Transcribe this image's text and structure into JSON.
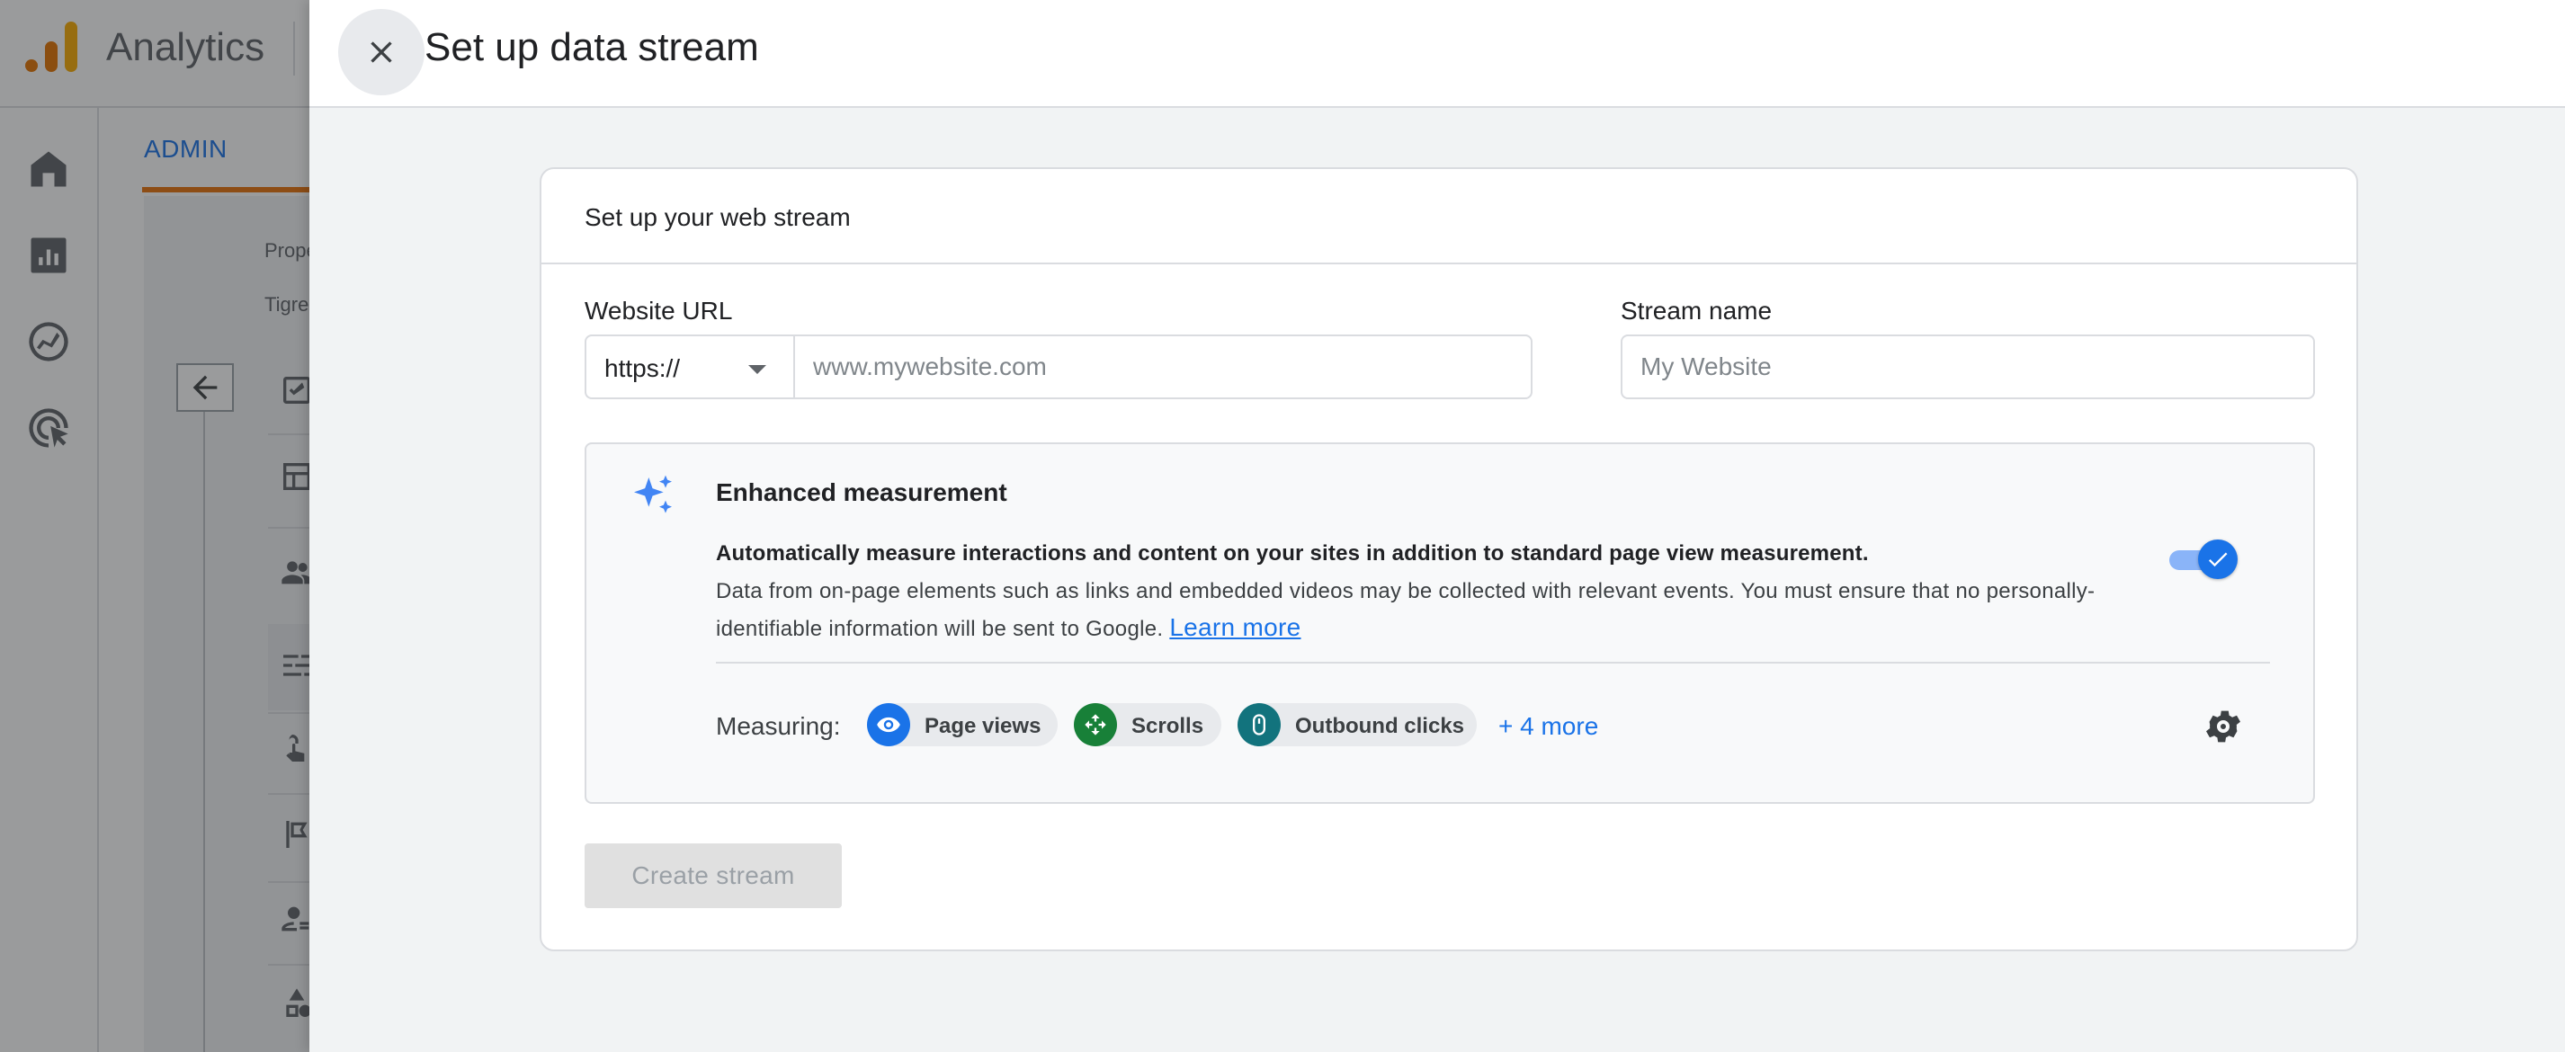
{
  "app": {
    "name": "Analytics",
    "admin_tab": "ADMIN",
    "property_label": "Prope",
    "property_value": "Tigre"
  },
  "panel": {
    "title": "Set up data stream"
  },
  "card": {
    "title": "Set up your web stream",
    "website_url_label": "Website URL",
    "protocol_value": "https://",
    "url_placeholder": "www.mywebsite.com",
    "stream_name_label": "Stream name",
    "stream_name_placeholder": "My Website",
    "create_button": "Create stream"
  },
  "enhanced": {
    "title": "Enhanced measurement",
    "description_bold": "Automatically measure interactions and content on your sites in addition to standard page view measurement.",
    "description": "Data from on-page elements such as links and embedded videos may be collected with relevant events. You must ensure that no personally-identifiable information will be sent to Google.",
    "learn_more": "Learn more",
    "enabled": true,
    "measuring_label": "Measuring:",
    "chips": [
      {
        "label": "Page views",
        "icon": "eye-icon",
        "color": "#1a73e8"
      },
      {
        "label": "Scrolls",
        "icon": "scroll-icon",
        "color": "#188038"
      },
      {
        "label": "Outbound clicks",
        "icon": "mouse-icon",
        "color": "#12737d"
      }
    ],
    "more_link": "+ 4 more"
  },
  "colors": {
    "accent": "#1a73e8",
    "tab_underline": "#e8710a"
  }
}
